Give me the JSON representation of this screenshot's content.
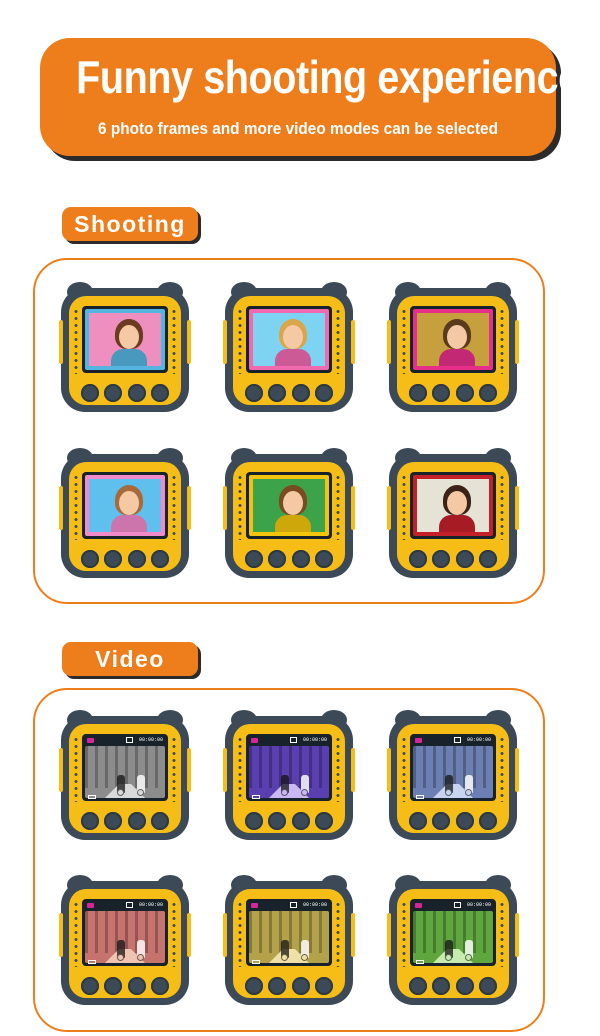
{
  "banner": {
    "title": "Funny shooting experience",
    "subtitle": "6 photo frames and more video modes can be selected"
  },
  "sections": {
    "shooting_label": "Shooting",
    "video_label": "Video"
  },
  "video_hud": {
    "time": "00:00:00"
  },
  "colors": {
    "accent": "#ee7e1c",
    "camera_body": "#f6bd16",
    "camera_trim": "#3b4a56"
  },
  "photo_frames": [
    {
      "frame": "#56b4e0",
      "bg": "#ef8fbf",
      "hair": "#6b3b1f"
    },
    {
      "frame": "#f06ab0",
      "bg": "#7fd3f2",
      "hair": "#d9a64a"
    },
    {
      "frame": "#e52f8a",
      "bg": "#c7a03e",
      "hair": "#5a3a1c"
    },
    {
      "frame": "#f08acb",
      "bg": "#5fc0ef",
      "hair": "#a86a3a"
    },
    {
      "frame": "#f2c40c",
      "bg": "#3ca34a",
      "hair": "#7a4a20"
    },
    {
      "frame": "#c3202a",
      "bg": "#e5e3d6",
      "hair": "#3b2417"
    }
  ],
  "video_filters": [
    {
      "name": "grayscale",
      "trees": "#8c8c8c",
      "path": "#d9d9d9"
    },
    {
      "name": "negative",
      "trees": "#5a3fb0",
      "path": "#c9b8f2"
    },
    {
      "name": "cool",
      "trees": "#6c7fb2",
      "path": "#c7d3ef"
    },
    {
      "name": "warm",
      "trees": "#c6726d",
      "path": "#f0c4b0"
    },
    {
      "name": "sepia",
      "trees": "#b3a24a",
      "path": "#efe0a8"
    },
    {
      "name": "green",
      "trees": "#5ea63d",
      "path": "#c8ecb0"
    }
  ]
}
